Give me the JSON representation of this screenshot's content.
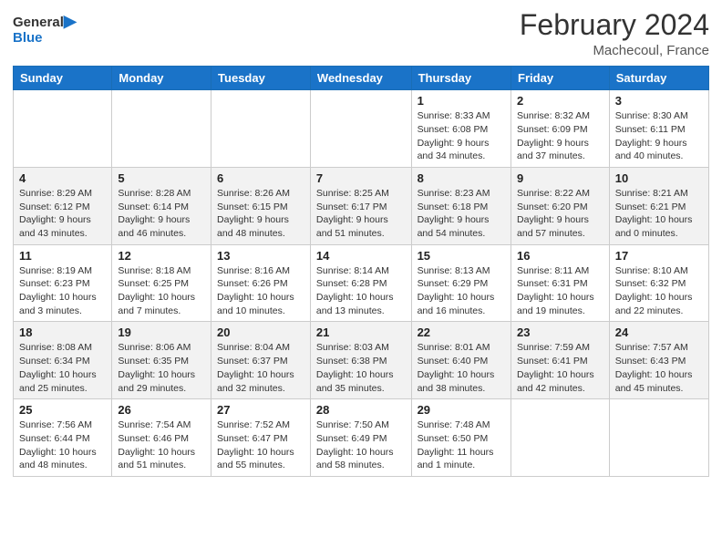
{
  "header": {
    "logo_line1": "General",
    "logo_line2": "Blue",
    "month_year": "February 2024",
    "location": "Machecoul, France"
  },
  "days_of_week": [
    "Sunday",
    "Monday",
    "Tuesday",
    "Wednesday",
    "Thursday",
    "Friday",
    "Saturday"
  ],
  "weeks": [
    [
      {
        "num": "",
        "info": ""
      },
      {
        "num": "",
        "info": ""
      },
      {
        "num": "",
        "info": ""
      },
      {
        "num": "",
        "info": ""
      },
      {
        "num": "1",
        "info": "Sunrise: 8:33 AM\nSunset: 6:08 PM\nDaylight: 9 hours and 34 minutes."
      },
      {
        "num": "2",
        "info": "Sunrise: 8:32 AM\nSunset: 6:09 PM\nDaylight: 9 hours and 37 minutes."
      },
      {
        "num": "3",
        "info": "Sunrise: 8:30 AM\nSunset: 6:11 PM\nDaylight: 9 hours and 40 minutes."
      }
    ],
    [
      {
        "num": "4",
        "info": "Sunrise: 8:29 AM\nSunset: 6:12 PM\nDaylight: 9 hours and 43 minutes."
      },
      {
        "num": "5",
        "info": "Sunrise: 8:28 AM\nSunset: 6:14 PM\nDaylight: 9 hours and 46 minutes."
      },
      {
        "num": "6",
        "info": "Sunrise: 8:26 AM\nSunset: 6:15 PM\nDaylight: 9 hours and 48 minutes."
      },
      {
        "num": "7",
        "info": "Sunrise: 8:25 AM\nSunset: 6:17 PM\nDaylight: 9 hours and 51 minutes."
      },
      {
        "num": "8",
        "info": "Sunrise: 8:23 AM\nSunset: 6:18 PM\nDaylight: 9 hours and 54 minutes."
      },
      {
        "num": "9",
        "info": "Sunrise: 8:22 AM\nSunset: 6:20 PM\nDaylight: 9 hours and 57 minutes."
      },
      {
        "num": "10",
        "info": "Sunrise: 8:21 AM\nSunset: 6:21 PM\nDaylight: 10 hours and 0 minutes."
      }
    ],
    [
      {
        "num": "11",
        "info": "Sunrise: 8:19 AM\nSunset: 6:23 PM\nDaylight: 10 hours and 3 minutes."
      },
      {
        "num": "12",
        "info": "Sunrise: 8:18 AM\nSunset: 6:25 PM\nDaylight: 10 hours and 7 minutes."
      },
      {
        "num": "13",
        "info": "Sunrise: 8:16 AM\nSunset: 6:26 PM\nDaylight: 10 hours and 10 minutes."
      },
      {
        "num": "14",
        "info": "Sunrise: 8:14 AM\nSunset: 6:28 PM\nDaylight: 10 hours and 13 minutes."
      },
      {
        "num": "15",
        "info": "Sunrise: 8:13 AM\nSunset: 6:29 PM\nDaylight: 10 hours and 16 minutes."
      },
      {
        "num": "16",
        "info": "Sunrise: 8:11 AM\nSunset: 6:31 PM\nDaylight: 10 hours and 19 minutes."
      },
      {
        "num": "17",
        "info": "Sunrise: 8:10 AM\nSunset: 6:32 PM\nDaylight: 10 hours and 22 minutes."
      }
    ],
    [
      {
        "num": "18",
        "info": "Sunrise: 8:08 AM\nSunset: 6:34 PM\nDaylight: 10 hours and 25 minutes."
      },
      {
        "num": "19",
        "info": "Sunrise: 8:06 AM\nSunset: 6:35 PM\nDaylight: 10 hours and 29 minutes."
      },
      {
        "num": "20",
        "info": "Sunrise: 8:04 AM\nSunset: 6:37 PM\nDaylight: 10 hours and 32 minutes."
      },
      {
        "num": "21",
        "info": "Sunrise: 8:03 AM\nSunset: 6:38 PM\nDaylight: 10 hours and 35 minutes."
      },
      {
        "num": "22",
        "info": "Sunrise: 8:01 AM\nSunset: 6:40 PM\nDaylight: 10 hours and 38 minutes."
      },
      {
        "num": "23",
        "info": "Sunrise: 7:59 AM\nSunset: 6:41 PM\nDaylight: 10 hours and 42 minutes."
      },
      {
        "num": "24",
        "info": "Sunrise: 7:57 AM\nSunset: 6:43 PM\nDaylight: 10 hours and 45 minutes."
      }
    ],
    [
      {
        "num": "25",
        "info": "Sunrise: 7:56 AM\nSunset: 6:44 PM\nDaylight: 10 hours and 48 minutes."
      },
      {
        "num": "26",
        "info": "Sunrise: 7:54 AM\nSunset: 6:46 PM\nDaylight: 10 hours and 51 minutes."
      },
      {
        "num": "27",
        "info": "Sunrise: 7:52 AM\nSunset: 6:47 PM\nDaylight: 10 hours and 55 minutes."
      },
      {
        "num": "28",
        "info": "Sunrise: 7:50 AM\nSunset: 6:49 PM\nDaylight: 10 hours and 58 minutes."
      },
      {
        "num": "29",
        "info": "Sunrise: 7:48 AM\nSunset: 6:50 PM\nDaylight: 11 hours and 1 minute."
      },
      {
        "num": "",
        "info": ""
      },
      {
        "num": "",
        "info": ""
      }
    ]
  ]
}
